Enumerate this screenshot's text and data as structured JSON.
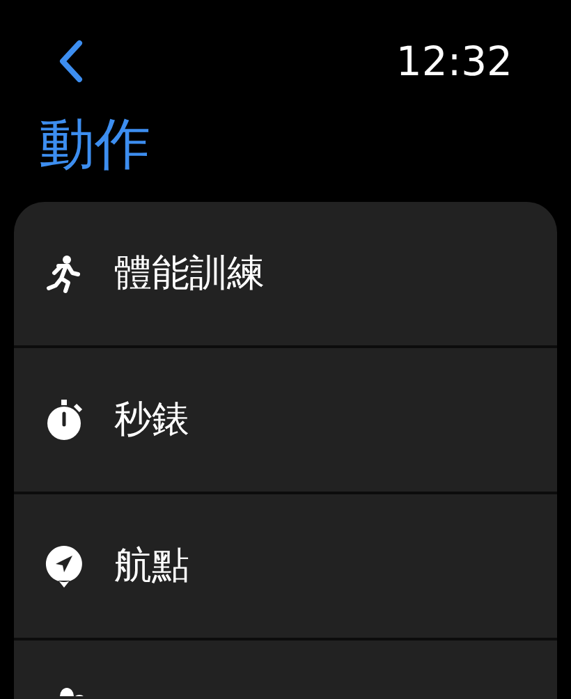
{
  "status_bar": {
    "time": "12:32"
  },
  "title": "動作",
  "menu": [
    {
      "label": "體能訓練"
    },
    {
      "label": "秒錶"
    },
    {
      "label": "航點"
    }
  ]
}
